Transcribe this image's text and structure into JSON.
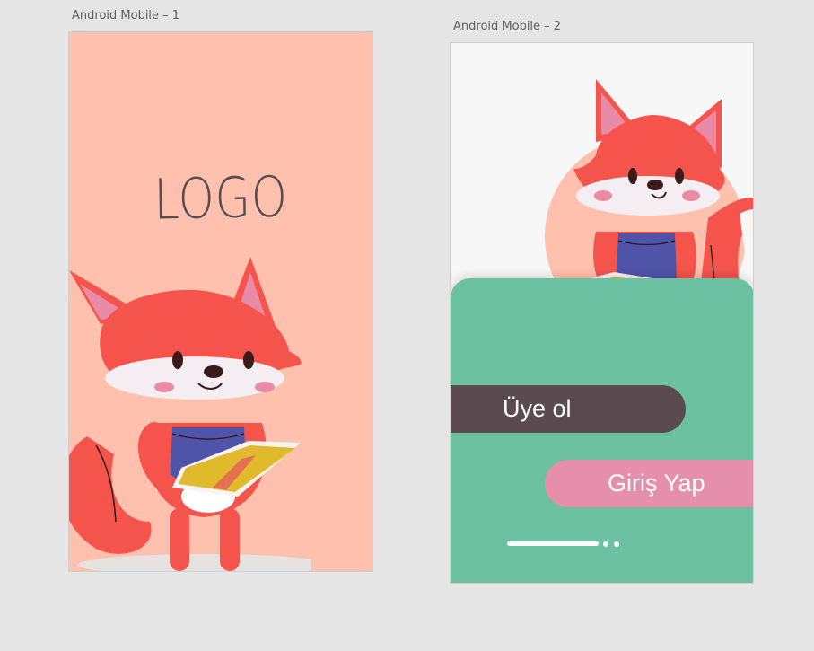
{
  "artboards": [
    {
      "label": "Android Mobile – 1",
      "logo_text": "LOGO"
    },
    {
      "label": "Android Mobile – 2",
      "signup_label": "Üye ol",
      "login_label": "Giriş Yap",
      "pager": {
        "pages": 3,
        "active_page": 1
      }
    }
  ],
  "colors": {
    "canvas": "#e5e5e5",
    "splash_bg": "#ffc1ad",
    "panel_green": "#6dc1a3",
    "signup_button": "#5b4a4f",
    "login_button": "#e58fad",
    "fox_orange": "#f4544c"
  },
  "icons": [
    "fox-illustration",
    "book-illustration"
  ]
}
